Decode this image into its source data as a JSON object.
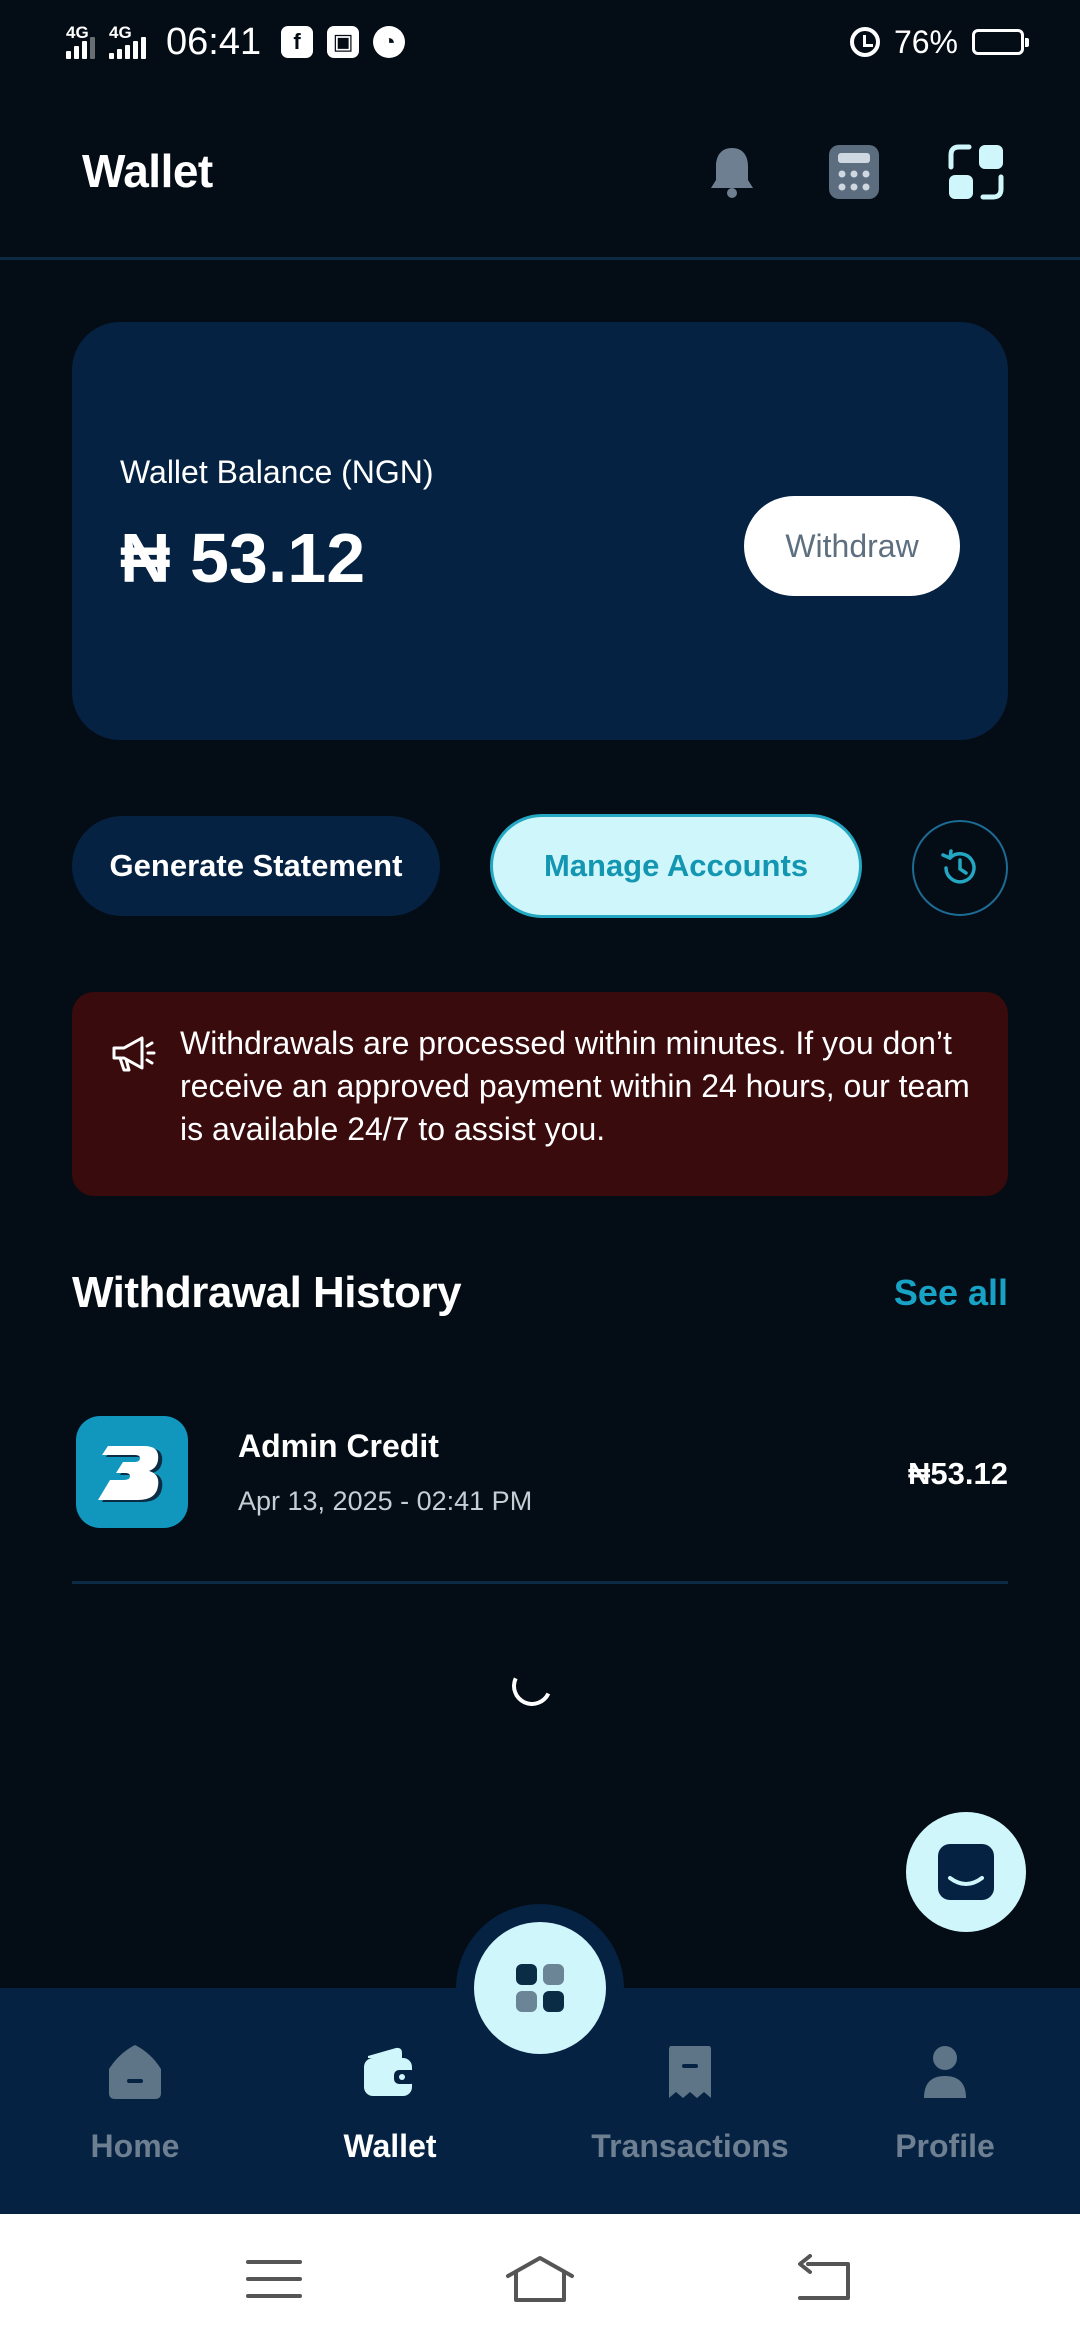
{
  "status_bar": {
    "network_1": "4G",
    "network_2": "4G",
    "time": "06:41",
    "battery_percent": "76%",
    "battery_level": 0.76
  },
  "header": {
    "title": "Wallet",
    "icons": [
      "bell-icon",
      "calculator-icon",
      "scan-icon"
    ]
  },
  "balance_card": {
    "label": "Wallet Balance (NGN)",
    "amount": "₦ 53.12",
    "withdraw_label": "Withdraw"
  },
  "actions": {
    "statement_label": "Generate Statement",
    "accounts_label": "Manage Accounts",
    "history_icon": "history-icon"
  },
  "notice": {
    "icon": "megaphone-icon",
    "text": "Withdrawals are processed within minutes. If you don’t receive an approved payment within 24 hours, our team is available 24/7 to assist you."
  },
  "history": {
    "title": "Withdrawal History",
    "see_all_label": "See all",
    "items": [
      {
        "title": "Admin Credit",
        "date": "Apr 13, 2025 - 02:41 PM",
        "amount": "₦53.12"
      }
    ]
  },
  "bottom_nav": {
    "items": [
      {
        "label": "Home",
        "icon": "home-icon",
        "active": false
      },
      {
        "label": "Wallet",
        "icon": "wallet-icon",
        "active": true
      },
      {
        "label": "Transactions",
        "icon": "receipt-icon",
        "active": false
      },
      {
        "label": "Profile",
        "icon": "profile-icon",
        "active": false
      }
    ]
  },
  "colors": {
    "background": "#040c15",
    "card": "#052242",
    "accent": "#18a3c6",
    "accent_light": "#cff6fa",
    "notice_bg": "#3a0b0d",
    "muted": "#6d7f90"
  }
}
